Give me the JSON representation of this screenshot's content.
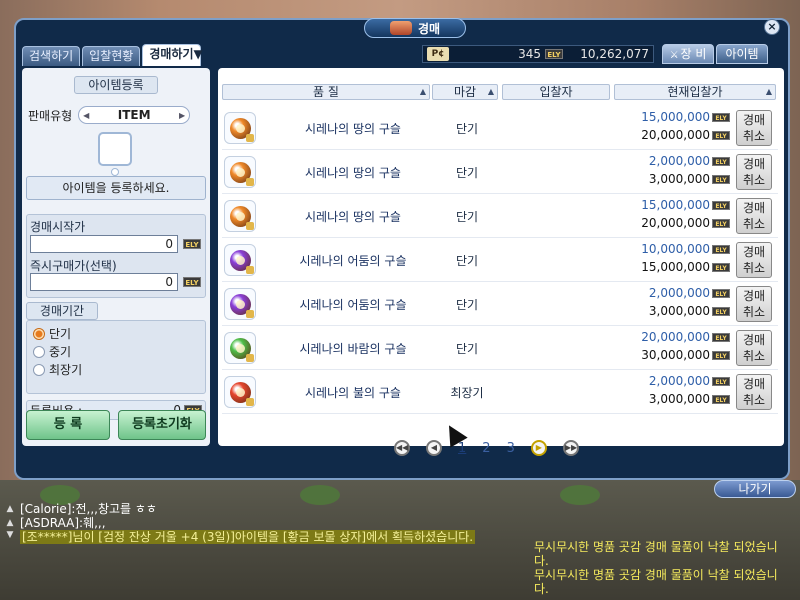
{
  "dialog": {
    "title": "경매",
    "close_label": "×",
    "tabs": [
      {
        "label": "검색하기",
        "active": false
      },
      {
        "label": "입찰현황",
        "active": false
      },
      {
        "label": "경매하기",
        "active": true
      }
    ],
    "currency": {
      "pc_icon": "P¢",
      "pc_value": "345",
      "ely_icon": "ELY",
      "ely_value": "10,262,077"
    },
    "right_tabs": [
      {
        "label": "장 비",
        "selected": true
      },
      {
        "label": "아이템",
        "selected": false
      }
    ],
    "exit_label": "나가기"
  },
  "register": {
    "section_label": "아이템등록",
    "type_label": "판매유형",
    "type_value": "ITEM",
    "hint": "아이템을 등록하세요.",
    "start_price_label": "경매시작가",
    "start_price_value": "0",
    "buyout_label": "즉시구매가(선택)",
    "buyout_value": "0",
    "ely_label": "ELY",
    "period_label": "경매기간",
    "periods": [
      {
        "label": "단기",
        "checked": true
      },
      {
        "label": "중기",
        "checked": false
      },
      {
        "label": "최장기",
        "checked": false
      }
    ],
    "fee_label": "등록비용 :",
    "fee_value": "0",
    "register_button": "등 록",
    "reset_button": "등록초기화"
  },
  "list": {
    "columns": [
      "품 질",
      "마감",
      "입찰자",
      "현재입찰가"
    ],
    "rows": [
      {
        "name": "시레나의 땅의 구슬",
        "period": "단기",
        "start_bid": "15,000,000",
        "current_bid": "20,000,000",
        "orb": "earth-orb",
        "orb_color": "#f08a2a"
      },
      {
        "name": "시레나의 땅의 구슬",
        "period": "단기",
        "start_bid": "2,000,000",
        "current_bid": "3,000,000",
        "orb": "earth-orb",
        "orb_color": "#f08a2a"
      },
      {
        "name": "시레나의 땅의 구슬",
        "period": "단기",
        "start_bid": "15,000,000",
        "current_bid": "20,000,000",
        "orb": "earth-orb",
        "orb_color": "#f08a2a"
      },
      {
        "name": "시레나의 어둠의 구슬",
        "period": "단기",
        "start_bid": "10,000,000",
        "current_bid": "15,000,000",
        "orb": "dark-orb",
        "orb_color": "#8a3fd9"
      },
      {
        "name": "시레나의 어둠의 구슬",
        "period": "단기",
        "start_bid": "2,000,000",
        "current_bid": "3,000,000",
        "orb": "dark-orb",
        "orb_color": "#8a3fd9"
      },
      {
        "name": "시레나의 바람의 구슬",
        "period": "단기",
        "start_bid": "20,000,000",
        "current_bid": "30,000,000",
        "orb": "wind-orb",
        "orb_color": "#4fbf4a"
      },
      {
        "name": "시레나의 불의 구슬",
        "period": "최장기",
        "start_bid": "2,000,000",
        "current_bid": "3,000,000",
        "orb": "fire-orb",
        "orb_color": "#e6462e"
      }
    ],
    "cancel_line1": "경매",
    "cancel_line2": "취소",
    "pages": [
      "1",
      "2",
      "3"
    ],
    "current_page": "1"
  },
  "chat": {
    "lines": [
      "[Calorie]:전,,,창고를 ㅎㅎ",
      "[ASDRAA]:훼,,,",
      "[조*****]님이 [검정 잔상 거울 +4 (3일)]아이템을 [황금 보물 상자]에서 획득하셨습니다."
    ],
    "notice": [
      "무시무시한 명품 곳감 경매 물품이 낙찰 되었습니다.",
      "무시무시한 명품 곳감 경매 물품이 낙찰 되었습니다."
    ]
  }
}
